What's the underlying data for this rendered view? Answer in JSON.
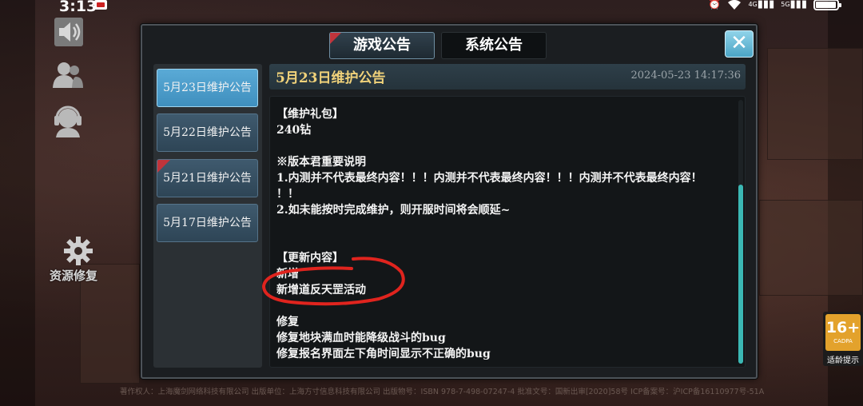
{
  "status_bar": {
    "time": "3:13",
    "network_labels": [
      "4G",
      "5G"
    ]
  },
  "side_panel": {
    "repair_label": "资源修复"
  },
  "tabs": [
    {
      "label": "游戏公告",
      "active": true
    },
    {
      "label": "系统公告",
      "active": false
    }
  ],
  "close_label": "✕",
  "notices": [
    {
      "label": "5月23日维护公告",
      "active": true,
      "ribbon": false
    },
    {
      "label": "5月22日维护公告",
      "active": false,
      "ribbon": false
    },
    {
      "label": "5月21日维护公告",
      "active": false,
      "ribbon": true
    },
    {
      "label": "5月17日维护公告",
      "active": false,
      "ribbon": false
    }
  ],
  "content": {
    "title": "5月23日维护公告",
    "datetime": "2024-05-23  14:17:36",
    "lines": {
      "gift_header": "【维护礼包】",
      "gift_value": "240钻",
      "note_header": "※版本君重要说明",
      "note_1": "1.内测并不代表最终内容！！！内测并不代表最终内容！！！内测并不代表最终内容！",
      "note_1b": "！！",
      "note_2": "2.如未能按时完成维护，则开服时间将会顺延~",
      "update_header": "【更新内容】",
      "new_header": "新增",
      "new_1": "新增道反天罡活动",
      "fix_header": "修复",
      "fix_1": "修复地块满血时能降级战斗的bug",
      "fix_2": "修复报名界面左下角时间显示不正确的bug"
    }
  },
  "age_rating": {
    "number": "16+",
    "org": "CADPA",
    "tip": "适龄提示"
  },
  "copyright": "著作权人：上海魔剑网络科技有限公司  出版单位：上海方寸信息科技有限公司 出版物号：ISBN 978-7-498-07247-4 批准文号：国新出审[2020]58号  ICP备案号：沪ICP备16110977号-51A",
  "colors": {
    "accent_cyan": "#3bb8b4",
    "title_gold": "#f0d27a",
    "ribbon_red": "#c0343b",
    "annotation_red": "#e0241e"
  }
}
